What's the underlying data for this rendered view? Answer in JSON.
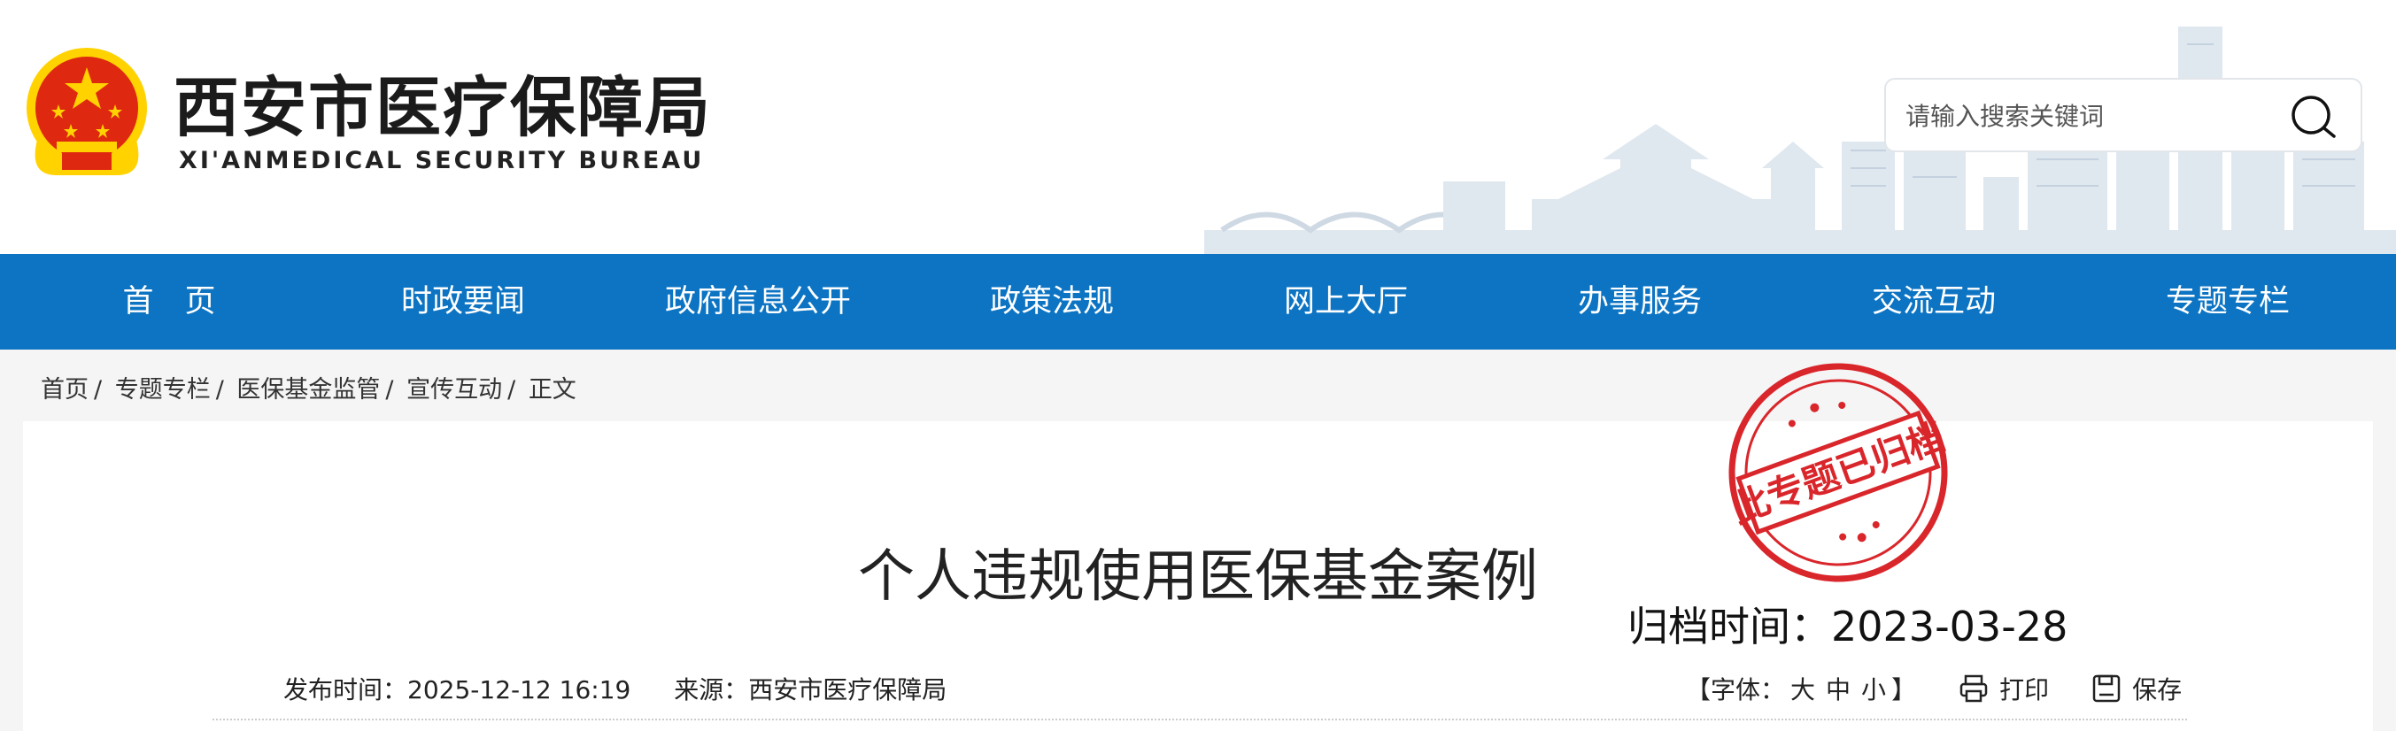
{
  "site": {
    "title": "西安市医疗保障局",
    "subtitle": "XI'ANMEDICAL SECURITY BUREAU"
  },
  "search": {
    "placeholder": "请输入搜索关键词",
    "value": ""
  },
  "nav": {
    "items": [
      {
        "label": "首　页"
      },
      {
        "label": "时政要闻"
      },
      {
        "label": "政府信息公开"
      },
      {
        "label": "政策法规"
      },
      {
        "label": "网上大厅"
      },
      {
        "label": "办事服务"
      },
      {
        "label": "交流互动"
      },
      {
        "label": "专题专栏"
      }
    ]
  },
  "breadcrumb": {
    "items": [
      "首页",
      "专题专栏",
      "医保基金监管",
      "宣传互动",
      "正文"
    ],
    "separator": "/"
  },
  "article": {
    "title": "个人违规使用医保基金案例",
    "archive_label": "归档时间：",
    "archive_date": "2023-03-28",
    "stamp_text": "此专题已归档",
    "publish_label": "发布时间：",
    "publish_value": "2025-12-12 16:19",
    "source_label": "来源：",
    "source_value": "西安市医疗保障局",
    "font_label": "【字体：",
    "font_large": "大",
    "font_medium": "中",
    "font_small": "小",
    "font_close": "】",
    "print_label": "打印",
    "save_label": "保存"
  },
  "colors": {
    "nav_bg": "#0c74c3",
    "stamp_red": "#d9262b",
    "emblem_red": "#de2910",
    "emblem_gold": "#ffd200"
  }
}
